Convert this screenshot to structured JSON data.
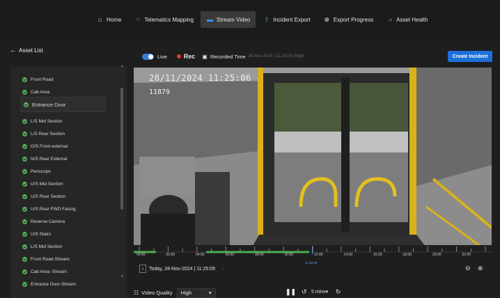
{
  "nav": {
    "items": [
      {
        "label": "Home",
        "icon": "home-icon",
        "glyph": "⌂",
        "color": "#e6e6e6"
      },
      {
        "label": "Telematics Mapping",
        "icon": "nodes-icon",
        "glyph": "⁘",
        "color": "#f5a623"
      },
      {
        "label": "Stream Video",
        "icon": "video-icon",
        "glyph": "▬",
        "color": "#3a9bff"
      },
      {
        "label": "Incident Export",
        "icon": "export-icon",
        "glyph": "⇧",
        "color": "#4caf50"
      },
      {
        "label": "Export Progress",
        "icon": "progress-icon",
        "glyph": "⊕",
        "color": "#e6e6e6"
      },
      {
        "label": "Asset Health",
        "icon": "health-icon",
        "glyph": "⩘",
        "color": "#4caf50"
      }
    ],
    "active_index": 2
  },
  "sidebar": {
    "back_label": "Asset List",
    "assets": [
      "Front Road",
      "Cab Area",
      "Entrance Door",
      "L/S Mid Section",
      "L/S Rear Section",
      "O/S Front external",
      "N/S Rear External",
      "Periscope",
      "U/S Mid Section",
      "U/S Rear Section",
      "U/S Rear FWD Facing",
      "Reverse Camera",
      "U/S Stairs",
      "L/S Mid Section",
      "Front Road-Stream",
      "Cab Area -Stream",
      "Entrance Door-Stream"
    ],
    "selected_index": 2,
    "check_color": "#5cb85c"
  },
  "player": {
    "live_label": "Live",
    "rec_label": "Rec",
    "recorded_label": "Recorded Time",
    "recorded_value": "28-Nov-2024 | 11:25:09 (High)",
    "create_incident_label": "Create Incident",
    "osd_timestamp": "28/11/2024 11:25:06",
    "osd_id": "11879",
    "accent_color": "#1d6fd8"
  },
  "timeline": {
    "hour_labels": [
      "00:00",
      "02:00",
      "04:00",
      "06:00",
      "08:00",
      "10:00",
      "12:00",
      "14:00",
      "16:00",
      "18:00",
      "20:00",
      "22:00"
    ],
    "cursor_label": "11:25:09",
    "date_label": "Today, 28-Nov-2024 | 11:25:09",
    "recorded_segments_color": "#4caf50"
  },
  "bottom": {
    "video_quality_label": "Video Quality",
    "video_quality_value": "High",
    "interval_label": "5 mins"
  }
}
